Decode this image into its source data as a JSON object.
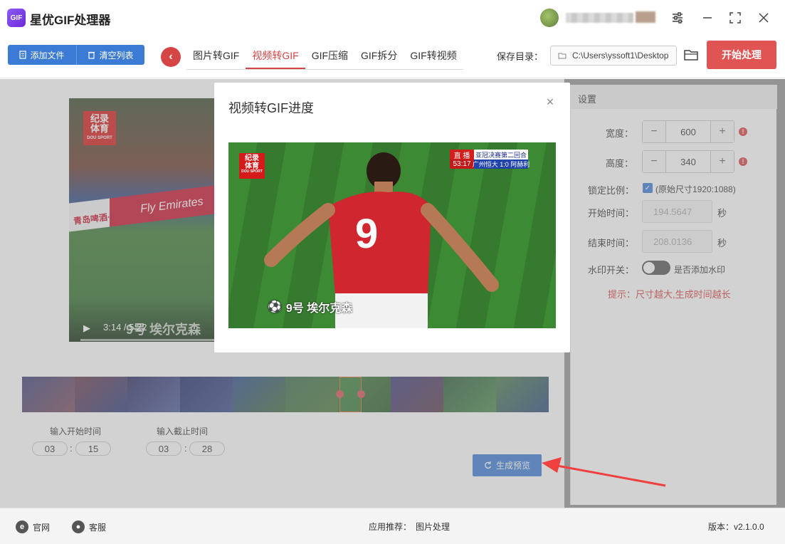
{
  "app": {
    "title": "星优GIF处理器",
    "logo_text": "GIF"
  },
  "toolbar": {
    "add_file": "添加文件",
    "clear_list": "清空列表",
    "tabs": [
      {
        "label": "图片转GIF",
        "active": false
      },
      {
        "label": "视频转GIF",
        "active": true
      },
      {
        "label": "GIF压缩",
        "active": false
      },
      {
        "label": "GIF拆分",
        "active": false
      },
      {
        "label": "GIF转视频",
        "active": false
      }
    ],
    "save_label": "保存目录：",
    "save_path": "C:\\Users\\yssoft1\\Desktop",
    "start_button": "开始处理"
  },
  "video": {
    "current_time": "3:14",
    "total_time": "5:22",
    "subtitle": "9号  埃尔克森",
    "banner_text": "Fly Emirates",
    "sponsor_text": "青岛啤酒·纯",
    "logo_line1": "纪录",
    "logo_line2": "体育",
    "logo_sub": "DOU SPORT"
  },
  "timeline": {
    "selection_fraction": 0.64
  },
  "time_inputs": {
    "start_label": "输入开始时间",
    "end_label": "输入截止时间",
    "start_min": "03",
    "start_sec": "15",
    "end_min": "03",
    "end_sec": "28",
    "separator": ":"
  },
  "preview_button": "生成预览",
  "settings": {
    "header": "设置",
    "width_label": "宽度：",
    "width_value": "600",
    "height_label": "高度：",
    "height_value": "340",
    "lock_label": "锁定比例：",
    "lock_checked": true,
    "lock_text": "(原始尺寸1920:1088)",
    "start_label": "开始时间：",
    "start_value": "194.5647",
    "end_label": "结束时间：",
    "end_value": "208.0136",
    "seconds_unit": "秒",
    "watermark_label": "水印开关：",
    "watermark_text": "是否添加水印",
    "hint": "提示：尺寸越大,生成时间越长"
  },
  "modal": {
    "title": "视频转GIF进度",
    "scoreboard": {
      "live": "直 播",
      "time": "53:17",
      "match_title": "亚冠决赛第二回合",
      "score": "广州恒大 1:0 阿赫利"
    },
    "player_number": "9",
    "subtitle": "9号  埃尔克森"
  },
  "footer": {
    "website": "官网",
    "support": "客服",
    "recommend_label": "应用推荐：",
    "recommend_value": "图片处理",
    "version": "版本：v2.1.0.0"
  },
  "colors": {
    "accent_red": "#d64545",
    "primary_blue": "#3b7bd6"
  }
}
